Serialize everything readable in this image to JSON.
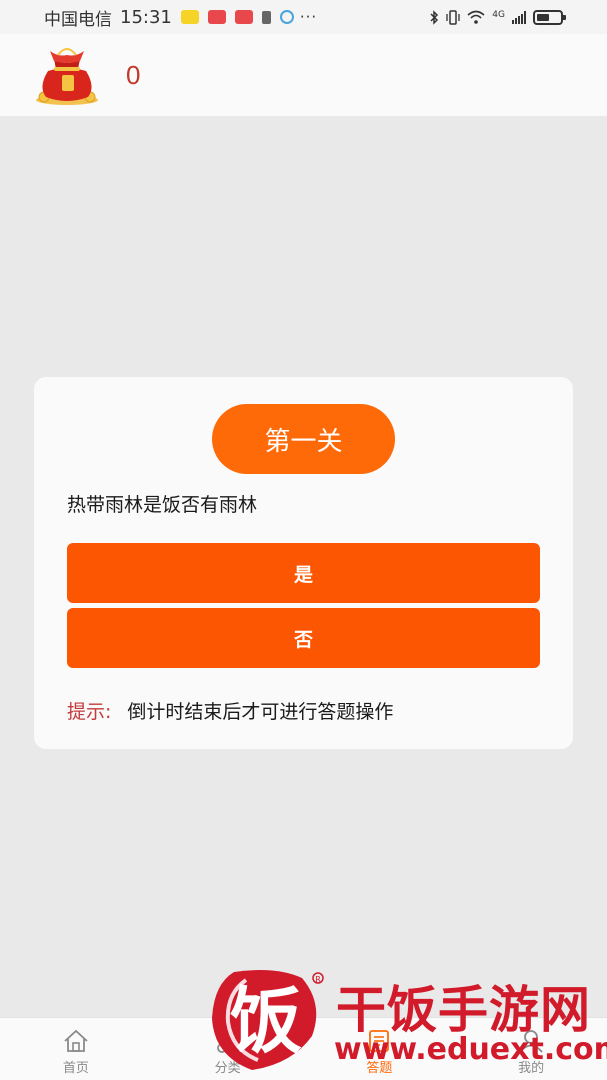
{
  "status_bar": {
    "carrier": "中国电信",
    "time": "15:31",
    "more": "···",
    "network": "4G"
  },
  "header": {
    "score": "0"
  },
  "quiz": {
    "level": "第一关",
    "question": "热带雨林是饭否有雨林",
    "options": [
      "是",
      "否"
    ],
    "hint_label": "提示:",
    "hint_text": "倒计时结束后才可进行答题操作"
  },
  "tabs": [
    {
      "label": "首页",
      "icon": "home-icon",
      "active": false
    },
    {
      "label": "分类",
      "icon": "category-icon",
      "active": false
    },
    {
      "label": "答题",
      "icon": "quiz-icon",
      "active": true
    },
    {
      "label": "我的",
      "icon": "profile-icon",
      "active": false
    }
  ],
  "watermark": {
    "logo_char": "饭",
    "brand": "干饭手游网",
    "url": "www.eduext.com"
  },
  "colors": {
    "accent": "#fe6a08",
    "button": "#fd5602",
    "hint_label": "#c33a3a",
    "watermark": "#d11a2a"
  }
}
